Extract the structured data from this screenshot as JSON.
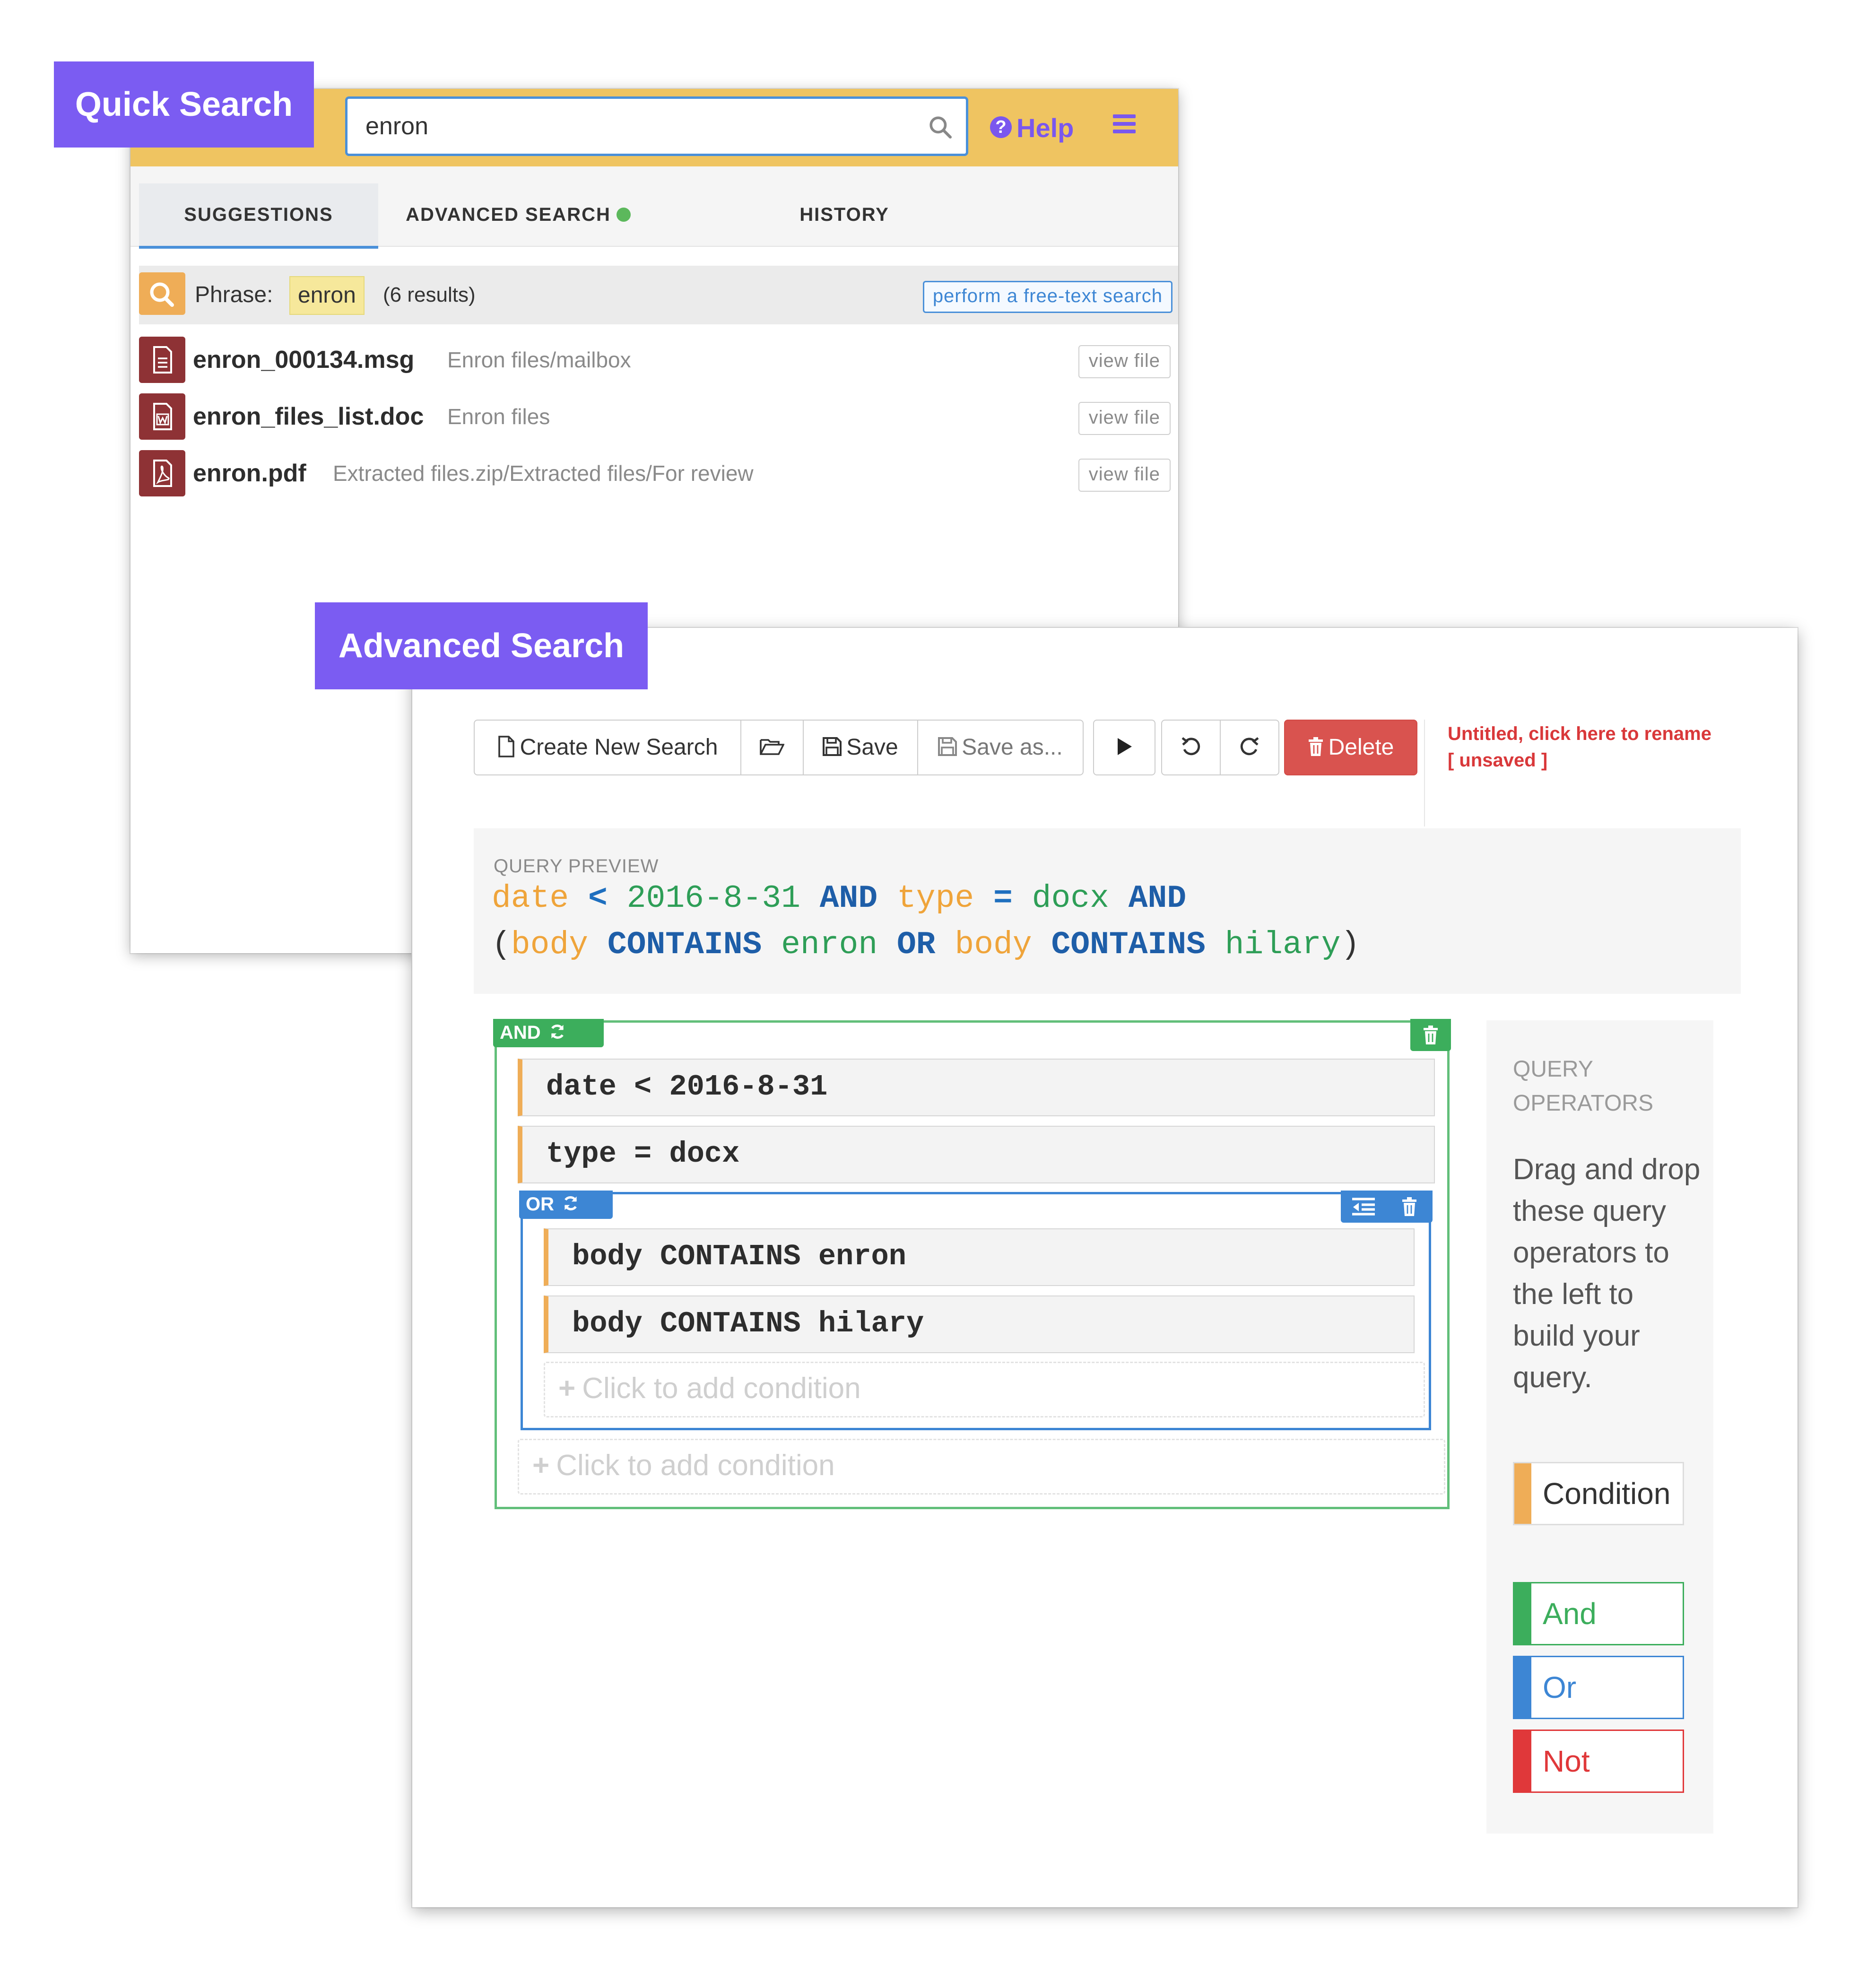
{
  "labels": {
    "quick_search": "Quick Search",
    "advanced_search": "Advanced Search"
  },
  "quick_search": {
    "search_value": "enron",
    "help_label": "Help",
    "tabs": [
      {
        "label": "SUGGESTIONS",
        "active": true
      },
      {
        "label": "ADVANCED SEARCH",
        "indicator": "green-dot"
      },
      {
        "label": "HISTORY"
      }
    ],
    "phrase": {
      "label": "Phrase:",
      "term": "enron",
      "count": "(6 results)",
      "action": "perform a free-text search"
    },
    "results": [
      {
        "name": "enron_000134.msg",
        "path": "Enron files/mailbox",
        "icon": "document-icon",
        "action": "view file"
      },
      {
        "name": "enron_files_list.doc",
        "path": "Enron files",
        "icon": "word-icon",
        "action": "view file"
      },
      {
        "name": "enron.pdf",
        "path": "Extracted files.zip/Extracted files/For review",
        "icon": "pdf-icon",
        "action": "view file"
      }
    ],
    "colors": {
      "header": "#efc461",
      "accent": "#7a57ee",
      "file_icon": "#8e3235"
    }
  },
  "advanced_search": {
    "toolbar": {
      "new_label": "Create New Search",
      "save_label": "Save",
      "save_as_label": "Save as...",
      "delete_label": "Delete"
    },
    "title": {
      "rename": "Untitled, click here to rename",
      "status": "[ unsaved ]"
    },
    "preview": {
      "label": "QUERY PREVIEW"
    },
    "builder": {
      "and_tag": "AND",
      "or_tag": "OR",
      "conditions": [
        {
          "field": "date",
          "op": "<",
          "value": "2016-8-31"
        },
        {
          "field": "type",
          "op": "=",
          "value": "docx"
        },
        {
          "field": "body",
          "op": "CONTAINS",
          "value": "enron"
        },
        {
          "field": "body",
          "op": "CONTAINS",
          "value": "hilary"
        }
      ],
      "add_condition": "Click to add condition"
    },
    "operators": {
      "title": "QUERY OPERATORS",
      "description": "Drag and drop these query operators to the left to build your query.",
      "items": [
        "Condition",
        "And",
        "Or",
        "Not"
      ]
    },
    "colors": {
      "and": "#3cae5c",
      "or": "#3d86d4",
      "not": "#e0383a",
      "condition": "#efad57",
      "delete": "#d9534f"
    }
  }
}
